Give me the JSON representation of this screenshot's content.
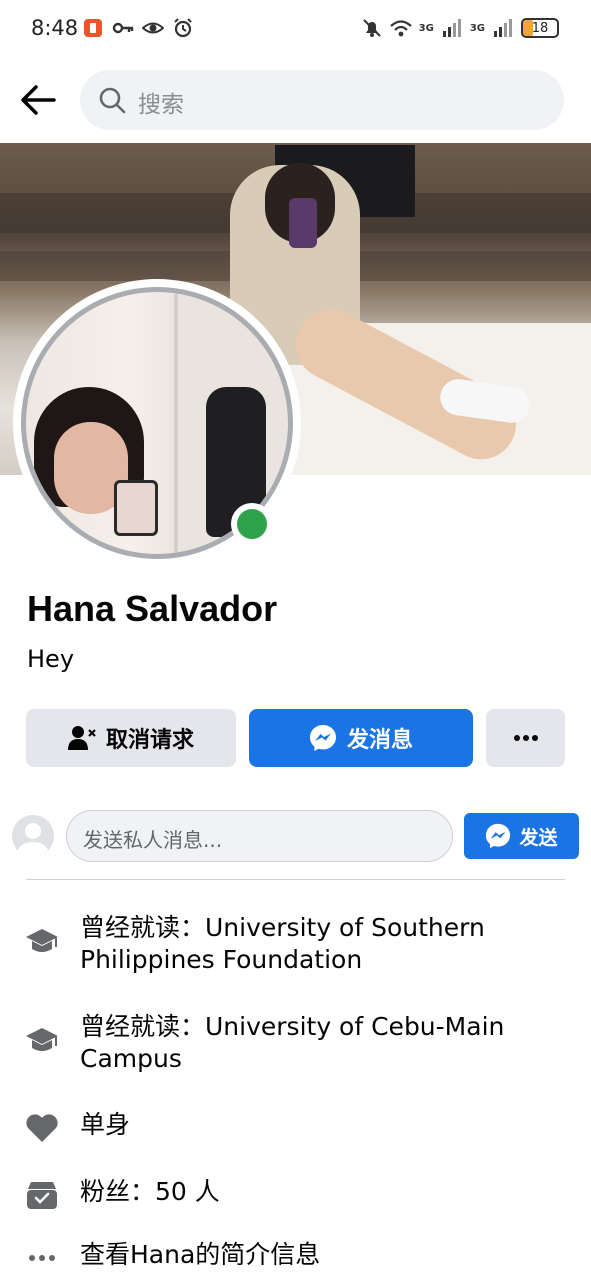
{
  "status_bar": {
    "time": "8:48",
    "network_1": "3G",
    "network_2": "3G",
    "battery": "18"
  },
  "search": {
    "placeholder": "搜索"
  },
  "profile": {
    "name": "Hana Salvador",
    "bio": "Hey",
    "online": true
  },
  "actions": {
    "cancel_request": "取消请求",
    "message": "发消息",
    "more": "···"
  },
  "message_box": {
    "placeholder": "发送私人消息...",
    "send": "发送"
  },
  "info": {
    "education_1": "曾经就读：University of Southern Philippines Foundation",
    "education_2": "曾经就读：University of Cebu-Main Campus",
    "relationship": "单身",
    "followers": "粉丝：50 人",
    "see_about": "查看Hana的简介信息"
  },
  "colors": {
    "accent": "#1b74e4",
    "online": "#31a24c",
    "button_gray": "#e4e6eb",
    "icon_gray": "#65676b"
  },
  "icons": {
    "back": "back-arrow-icon",
    "search": "search-icon",
    "education": "graduation-cap-icon",
    "relationship": "heart-icon",
    "followers": "followers-box-icon",
    "more": "more-dots-icon",
    "messenger": "messenger-icon",
    "cancel_request": "person-cancel-icon"
  }
}
